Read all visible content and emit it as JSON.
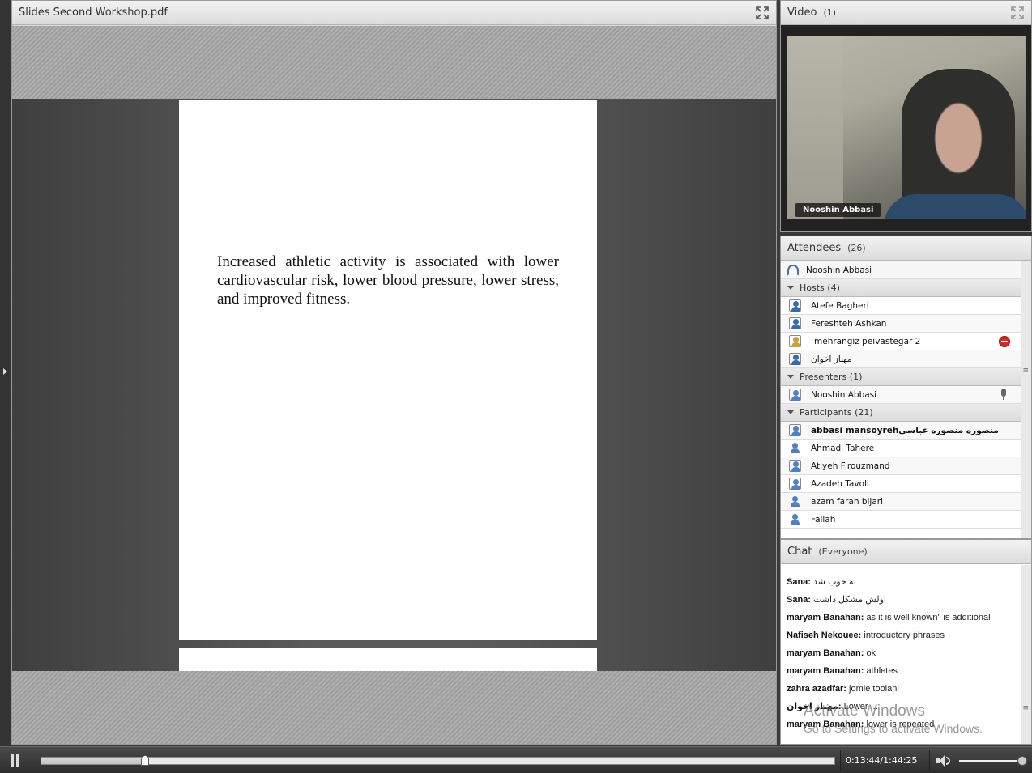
{
  "share": {
    "title": "Slides Second Workshop.pdf",
    "slide_text": "Increased athletic activity is associated with lower cardiovascular risk, lower blood pressure, lower stress, and improved fitness."
  },
  "video": {
    "title": "Video",
    "count": "(1)",
    "presenter_name": "Nooshin Abbasi"
  },
  "attendees": {
    "title": "Attendees",
    "count": "(26)",
    "me": "Nooshin Abbasi",
    "hosts_label": "Hosts (4)",
    "hosts": [
      "Atefe Bagheri",
      "Fereshteh Ashkan",
      "mehrangiz peivastegar 2",
      "مهناز اخوان"
    ],
    "presenters_label": "Presenters (1)",
    "presenters": [
      "Nooshin Abbasi"
    ],
    "participants_label": "Participants (21)",
    "participants": [
      "abbasi mansoyrehمنصوره منصوره عباسی",
      "Ahmadi Tahere",
      "Atiyeh Firouzmand",
      "Azadeh Tavoli",
      "azam farah bijari",
      "Fallah"
    ]
  },
  "chat": {
    "title": "Chat",
    "scope": "(Everyone)",
    "messages": [
      {
        "sender": "Sana:",
        "text": "نه خوب شد"
      },
      {
        "sender": "Sana:",
        "text": "اولش مشکل داشت"
      },
      {
        "sender": "maryam Banahan:",
        "text": "as it is well known\" is additional"
      },
      {
        "sender": "Nafiseh Nekouee:",
        "text": "introductory phrases"
      },
      {
        "sender": "maryam Banahan:",
        "text": "ok"
      },
      {
        "sender": "maryam Banahan:",
        "text": "athletes"
      },
      {
        "sender": "zahra azadfar:",
        "text": "jomle toolani"
      },
      {
        "sender": "مهناز اخوان:",
        "text": "Lower ..."
      },
      {
        "sender": "maryam Banahan:",
        "text": "lower is repeated"
      }
    ],
    "watermark_title": "Activate Windows",
    "watermark_sub": "Go to Settings to activate Windows."
  },
  "playback": {
    "time": "0:13:44/1:44:25",
    "progress": 0.1316,
    "volume": 1.0
  }
}
